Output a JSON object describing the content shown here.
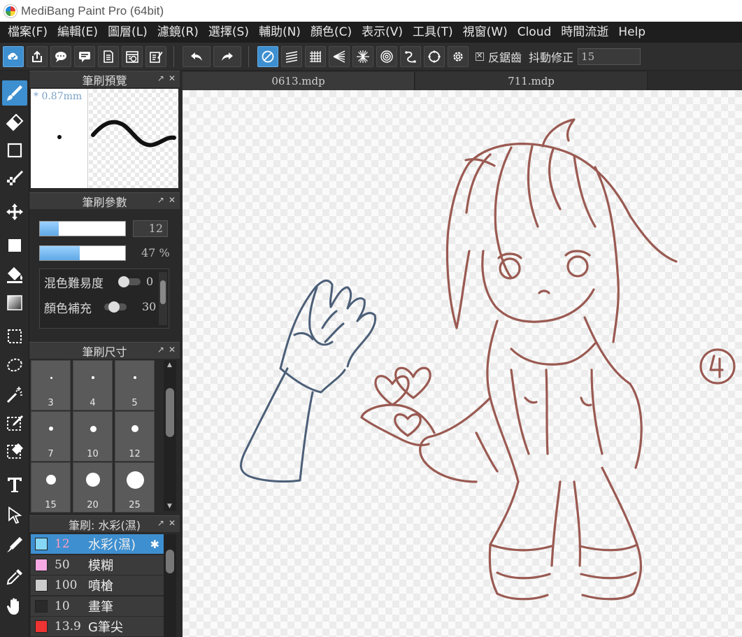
{
  "window": {
    "title": "MediBang Paint Pro (64bit)"
  },
  "menu": [
    "檔案(F)",
    "編輯(E)",
    "圖層(L)",
    "濾鏡(R)",
    "選擇(S)",
    "輔助(N)",
    "顏色(C)",
    "表示(V)",
    "工具(T)",
    "視窗(W)",
    "Cloud",
    "時間流逝",
    "Help"
  ],
  "toolbar": {
    "antialias_label": "反鋸齒",
    "stabilizer_label": "抖動修正",
    "stabilizer_value": "15"
  },
  "panels": {
    "preview_title": "筆刷預覽",
    "preview_size": "* 0.87mm",
    "params_title": "筆刷參數",
    "size_value": "12",
    "opacity_value": "47 %",
    "size_fill_fraction": 0.22,
    "opacity_fill_fraction": 0.47,
    "blend_label": "混色難易度",
    "blend_value": "0",
    "color_fill_label": "顏色補充",
    "color_fill_value": "30",
    "size_title": "筆刷尺寸",
    "sizes": [
      "3",
      "4",
      "5",
      "7",
      "10",
      "12",
      "15",
      "20",
      "25"
    ],
    "brush_title": "筆刷: 水彩(濕)",
    "brushes": [
      {
        "size": "12",
        "name": "水彩(濕)",
        "color": "#86d7f5",
        "selected": true
      },
      {
        "size": "50",
        "name": "模糊",
        "color": "#f7a9e3",
        "selected": false
      },
      {
        "size": "100",
        "name": "噴槍",
        "color": "#cccccc",
        "selected": false
      },
      {
        "size": "10",
        "name": "畫筆",
        "color": "#2a2a2a",
        "selected": false
      },
      {
        "size": "13.9",
        "name": "G筆尖",
        "color": "#ee3333",
        "selected": false
      }
    ]
  },
  "tabs": [
    "0613.mdp",
    "711.mdp"
  ],
  "colors": {
    "accent": "#3d8fd0",
    "sketch_brown": "#9a5a52",
    "sketch_blue": "#4c5f78"
  }
}
